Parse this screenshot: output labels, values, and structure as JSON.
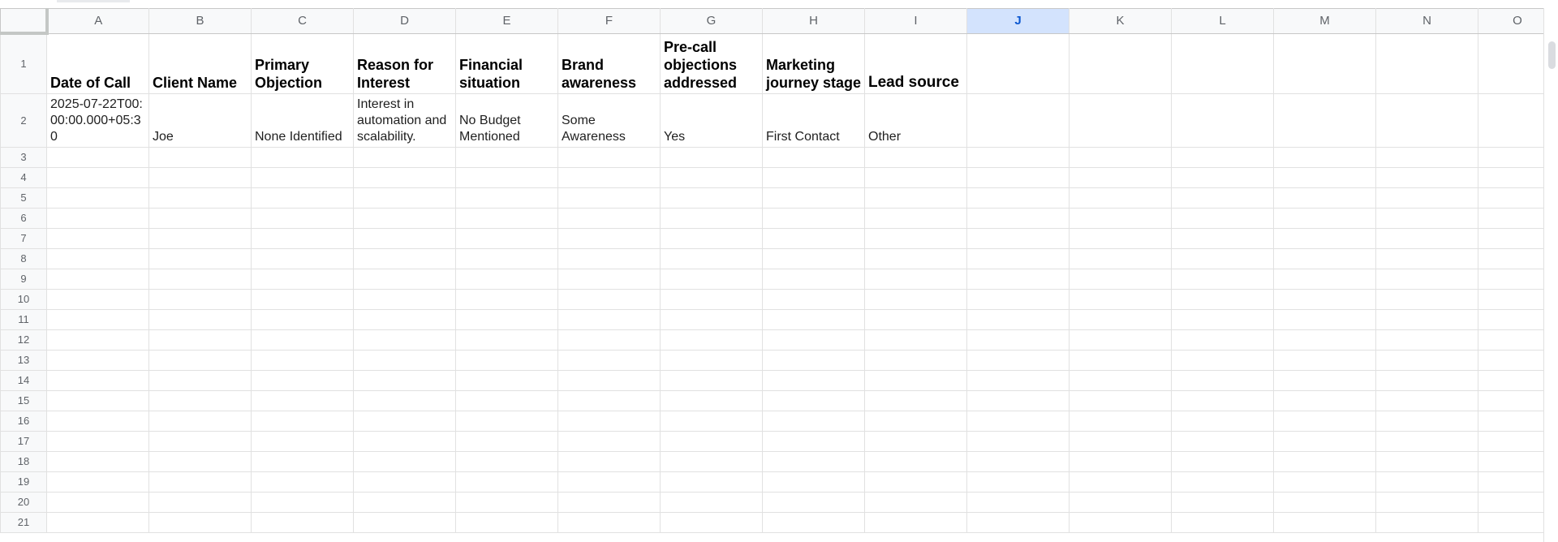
{
  "columns": [
    "A",
    "B",
    "C",
    "D",
    "E",
    "F",
    "G",
    "H",
    "I",
    "J",
    "K",
    "L",
    "M",
    "N",
    "O"
  ],
  "selected_column": "J",
  "headers": [
    "Date of Call",
    "Client Name",
    "Primary Objection",
    "Reason for Interest",
    "Financial situation",
    "Brand awareness",
    "Pre-call objections addressed",
    "Marketing journey stage",
    "Lead source"
  ],
  "row2": [
    "2025-07-22T00:00:00.000+05:30",
    "Joe",
    "None Identified",
    "Interest in automation and scalability.",
    "No Budget Mentioned",
    "Some Awareness",
    "Yes",
    "First Contact",
    "Other"
  ],
  "row_numbers": [
    "1",
    "2",
    "3",
    "4",
    "5",
    "6",
    "7",
    "8",
    "9",
    "10",
    "11",
    "12",
    "13",
    "14",
    "15",
    "16",
    "17",
    "18",
    "19",
    "20",
    "21"
  ]
}
